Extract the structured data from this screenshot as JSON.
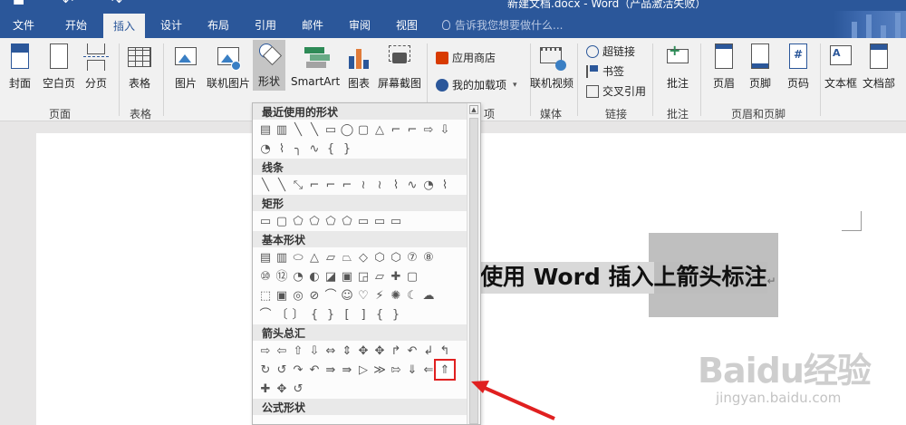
{
  "titlebar": {
    "quick_access": [
      "▬",
      "↶",
      "↷"
    ],
    "window_title": "新建文档.docx - Word（产品激活失败）"
  },
  "tabs": [
    "文件",
    "开始",
    "插入",
    "设计",
    "布局",
    "引用",
    "邮件",
    "审阅",
    "视图"
  ],
  "active_tab": "插入",
  "tell_me": "告诉我您想要做什么...",
  "ribbon": {
    "pages": {
      "cover": "封面",
      "blank": "空白页",
      "break": "分页",
      "group": "页面"
    },
    "tables": {
      "table": "表格",
      "group": "表格"
    },
    "illustrations": {
      "picture": "图片",
      "online_picture": "联机图片",
      "shapes": "形状",
      "smartart": "SmartArt",
      "chart": "图表",
      "screenshot": "屏幕截图"
    },
    "addins": {
      "store": "应用商店",
      "my_addins": "我的加载项",
      "group": "项"
    },
    "media": {
      "online_video": "联机视频",
      "group": "媒体"
    },
    "links": {
      "hyperlink": "超链接",
      "bookmark": "书签",
      "crossref": "交叉引用",
      "group": "链接"
    },
    "comments": {
      "comment": "批注",
      "group": "批注"
    },
    "header_footer": {
      "header": "页眉",
      "footer": "页脚",
      "page_number": "页码",
      "group": "页眉和页脚"
    },
    "text": {
      "textbox": "文本框",
      "docparts": "文档部"
    }
  },
  "document": {
    "heading_prefix": "使用 Word 插入",
    "heading_selected": "上箭头标注",
    "para_mark": "↵"
  },
  "shapes_menu": {
    "categories": {
      "recent": "最近使用的形状",
      "lines": "线条",
      "rects": "矩形",
      "basic": "基本形状",
      "arrows": "箭头总汇",
      "equation": "公式形状"
    },
    "recent_row1": [
      "▤",
      "▥",
      "╲",
      "╲",
      "▭",
      "◯",
      "▢",
      "△",
      "⌐",
      "⌐",
      "⇨",
      "⇩"
    ],
    "recent_row2": [
      "◔",
      "⌇",
      "╮",
      "∿",
      "{",
      "}"
    ],
    "lines_row": [
      "╲",
      "╲",
      "⤡",
      "⌐",
      "⌐",
      "⌐",
      "≀",
      "≀",
      "⌇",
      "∿",
      "◔",
      "⌇"
    ],
    "rects_row": [
      "▭",
      "▢",
      "⬠",
      "⬠",
      "⬠",
      "⬠",
      "▭",
      "▭",
      "▭"
    ],
    "basic_row1": [
      "▤",
      "▥",
      "⬭",
      "△",
      "▱",
      "⏢",
      "◇",
      "⬡",
      "⬡",
      "⑦",
      "⑧"
    ],
    "basic_row2": [
      "⑩",
      "⑫",
      "◔",
      "◐",
      "◪",
      "▣",
      "◲",
      "▱",
      "✚",
      "▢"
    ],
    "basic_row3": [
      "⬚",
      "▣",
      "◎",
      "⊘",
      "⌒",
      "☺",
      "♡",
      "⚡",
      "✺",
      "☾",
      "☁"
    ],
    "basic_row4": [
      "⌒",
      "〔",
      "〕",
      "{",
      "}",
      "[",
      "]",
      "{",
      "}"
    ],
    "arrows_row1": [
      "⇨",
      "⇦",
      "⇧",
      "⇩",
      "⇔",
      "⇕",
      "✥",
      "✥",
      "↱",
      "↶",
      "↲",
      "↰"
    ],
    "arrows_row2": [
      "↻",
      "↺",
      "↷",
      "↶",
      "⇛",
      "⇛",
      "▷",
      "≫",
      "⇰",
      "⇓",
      "⇐",
      "⇑"
    ],
    "arrows_row3": [
      "✚",
      "✥",
      "↺"
    ],
    "highlighted": "⇑"
  },
  "watermark": {
    "main": "Baidu经验",
    "sub": "jingyan.baidu.com"
  },
  "colors": {
    "word_blue": "#2b579a",
    "annotation_red": "#e02020",
    "selection_gray": "#bfbfbf"
  }
}
